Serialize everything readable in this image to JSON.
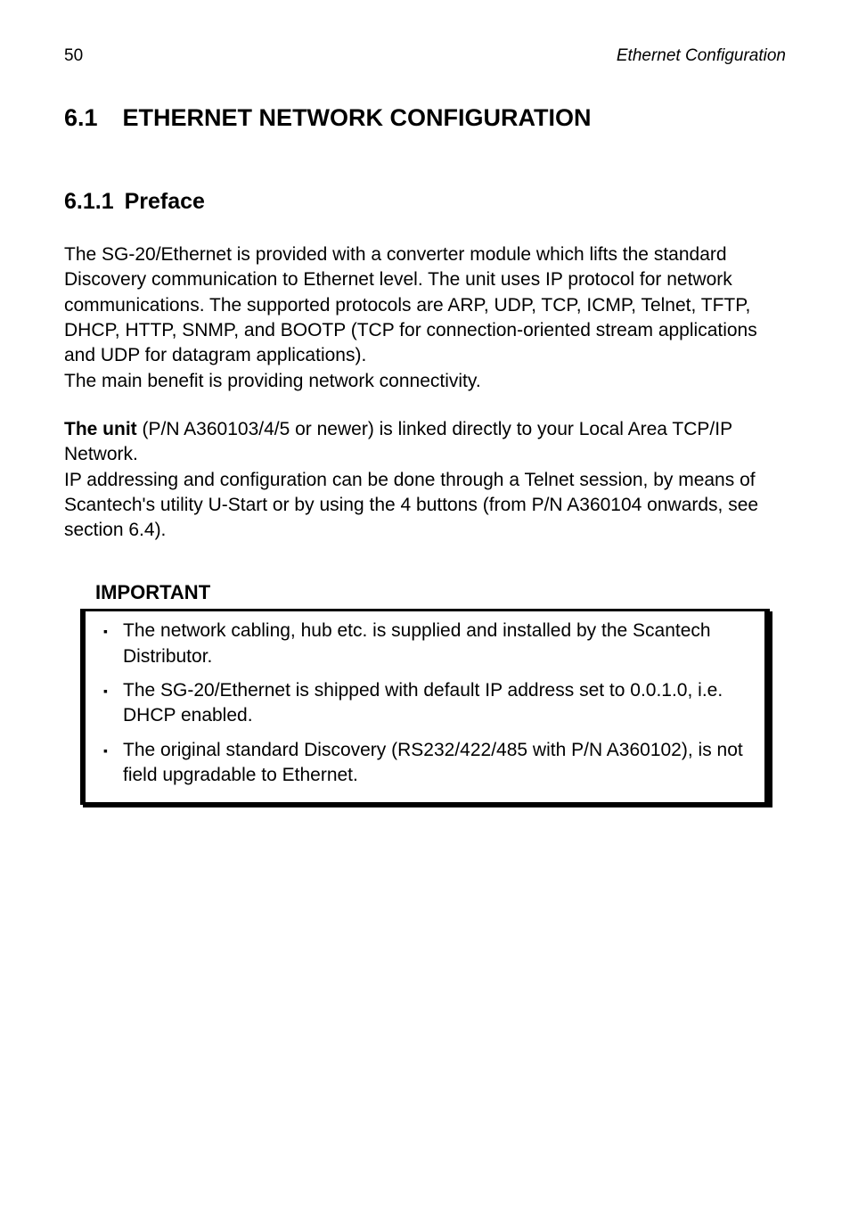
{
  "header": {
    "page_number": "50",
    "running_title": "Ethernet Configuration"
  },
  "section": {
    "h1_number": "6.1",
    "h1_title": "ETHERNET NETWORK CONFIGURATION",
    "h2_number": "6.1.1",
    "h2_title": "Preface"
  },
  "paragraphs": {
    "p1": "The SG-20/Ethernet is provided with a converter module which lifts the standard Discovery communication to Ethernet level. The unit uses IP protocol for network communications. The supported protocols are ARP, UDP, TCP, ICMP, Telnet, TFTP, DHCP, HTTP, SNMP, and BOOTP  (TCP for connection-oriented stream applications and UDP for datagram applications).",
    "p1b": "The main benefit is providing network connectivity.",
    "p2_bold": "The unit",
    "p2_rest": " (P/N A360103/4/5 or newer) is linked directly to your Local Area TCP/IP Network.",
    "p2b": "IP addressing and configuration can be done through a Telnet session, by means of Scantech's utility U-Start or by using the 4 buttons (from P/N A360104 onwards, see section 6.4)."
  },
  "important": {
    "label": "IMPORTANT",
    "items": [
      "The network cabling, hub etc. is supplied and installed by the Scantech Distributor.",
      "The SG-20/Ethernet is shipped with default IP address set to 0.0.1.0, i.e. DHCP enabled.",
      "The original standard Discovery (RS232/422/485 with P/N A360102), is not field upgradable to Ethernet."
    ]
  }
}
